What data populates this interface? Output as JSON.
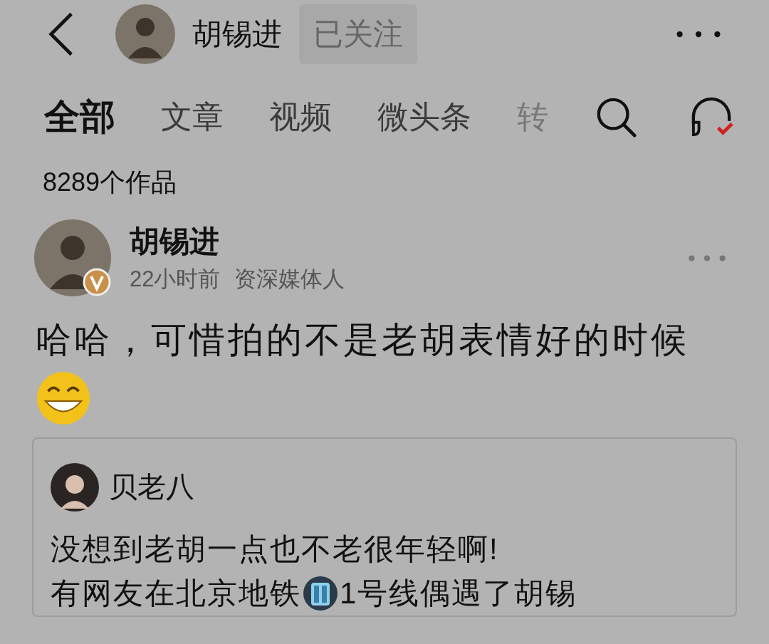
{
  "header": {
    "name": "胡锡进",
    "follow_button": "已关注"
  },
  "tabs": [
    {
      "label": "全部",
      "selected": true
    },
    {
      "label": "文章",
      "selected": false
    },
    {
      "label": "视频",
      "selected": false
    },
    {
      "label": "微头条",
      "selected": false
    },
    {
      "label": "转",
      "selected": false
    }
  ],
  "works_count": "8289个作品",
  "post": {
    "author": "胡锡进",
    "verified": true,
    "time": "22小时前",
    "author_title": "资深媒体人",
    "text": "哈哈，可惜拍的不是老胡表情好的时候",
    "quote": {
      "author": "贝老八",
      "line": "没想到老胡一点也不老很年轻啊!",
      "cut_before": "有网友在北京地铁",
      "cut_after": "1号线偶遇了胡锡"
    }
  }
}
